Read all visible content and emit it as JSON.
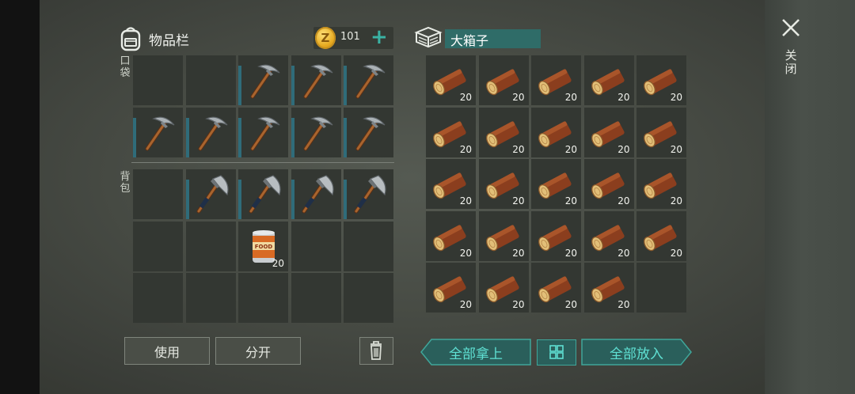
{
  "inventory": {
    "title": "物品栏",
    "coins": "101",
    "pocket_label": "口袋",
    "backpack_label": "背包",
    "pocket_slots": [
      {
        "item": "",
        "qty": ""
      },
      {
        "item": "",
        "qty": ""
      },
      {
        "item": "pickaxe",
        "qty": ""
      },
      {
        "item": "pickaxe",
        "qty": ""
      },
      {
        "item": "pickaxe",
        "qty": ""
      },
      {
        "item": "pickaxe",
        "qty": ""
      },
      {
        "item": "pickaxe",
        "qty": ""
      },
      {
        "item": "pickaxe",
        "qty": ""
      },
      {
        "item": "pickaxe",
        "qty": ""
      },
      {
        "item": "pickaxe",
        "qty": ""
      }
    ],
    "backpack_slots": [
      {
        "item": "",
        "qty": ""
      },
      {
        "item": "axe",
        "qty": ""
      },
      {
        "item": "axe",
        "qty": ""
      },
      {
        "item": "axe",
        "qty": ""
      },
      {
        "item": "axe",
        "qty": ""
      },
      {
        "item": "",
        "qty": ""
      },
      {
        "item": "",
        "qty": ""
      },
      {
        "item": "food-can",
        "qty": "20"
      },
      {
        "item": "",
        "qty": ""
      },
      {
        "item": "",
        "qty": ""
      },
      {
        "item": "",
        "qty": ""
      },
      {
        "item": "",
        "qty": ""
      },
      {
        "item": "",
        "qty": ""
      },
      {
        "item": "",
        "qty": ""
      },
      {
        "item": "",
        "qty": ""
      }
    ],
    "use_label": "使用",
    "split_label": "分开"
  },
  "container": {
    "title": "大箱子",
    "slots": [
      {
        "item": "log",
        "qty": "20"
      },
      {
        "item": "log",
        "qty": "20"
      },
      {
        "item": "log",
        "qty": "20"
      },
      {
        "item": "log",
        "qty": "20"
      },
      {
        "item": "log",
        "qty": "20"
      },
      {
        "item": "log",
        "qty": "20"
      },
      {
        "item": "log",
        "qty": "20"
      },
      {
        "item": "log",
        "qty": "20"
      },
      {
        "item": "log",
        "qty": "20"
      },
      {
        "item": "log",
        "qty": "20"
      },
      {
        "item": "log",
        "qty": "20"
      },
      {
        "item": "log",
        "qty": "20"
      },
      {
        "item": "log",
        "qty": "20"
      },
      {
        "item": "log",
        "qty": "20"
      },
      {
        "item": "log",
        "qty": "20"
      },
      {
        "item": "log",
        "qty": "20"
      },
      {
        "item": "log",
        "qty": "20"
      },
      {
        "item": "log",
        "qty": "20"
      },
      {
        "item": "log",
        "qty": "20"
      },
      {
        "item": "log",
        "qty": "20"
      },
      {
        "item": "log",
        "qty": "20"
      },
      {
        "item": "log",
        "qty": "20"
      },
      {
        "item": "log",
        "qty": "20"
      },
      {
        "item": "log",
        "qty": "20"
      },
      {
        "item": "",
        "qty": ""
      }
    ],
    "take_all_label": "全部拿上",
    "put_all_label": "全部放入"
  },
  "close_label": "关闭",
  "colors": {
    "accent_teal": "#3fa69a",
    "title_bg": "#2f6c68",
    "slot_bg": "#333732",
    "durability": "#2f6c7a"
  }
}
